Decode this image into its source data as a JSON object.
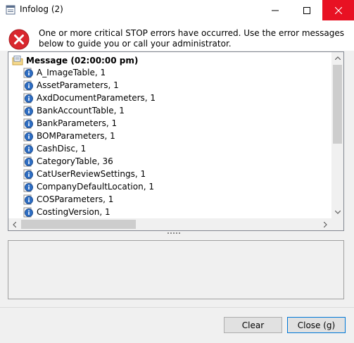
{
  "window": {
    "title": "Infolog (2)",
    "icons": {
      "app": "infolog-icon",
      "minimize": "minimize-icon",
      "maximize": "maximize-icon",
      "close": "close-icon"
    },
    "accent_close": "#e81123"
  },
  "header": {
    "icon": "stop-error-icon",
    "message": "One or more critical STOP errors have occurred. Use the error messages below to guide you or call your administrator."
  },
  "tree": {
    "root": {
      "icon": "message-folder-icon",
      "label": "Message (02:00:00 pm)"
    },
    "items": [
      {
        "icon": "info-icon",
        "label": "A_ImageTable, 1"
      },
      {
        "icon": "info-icon",
        "label": "AssetParameters, 1"
      },
      {
        "icon": "info-icon",
        "label": "AxdDocumentParameters, 1"
      },
      {
        "icon": "info-icon",
        "label": "BankAccountTable, 1"
      },
      {
        "icon": "info-icon",
        "label": "BankParameters, 1"
      },
      {
        "icon": "info-icon",
        "label": "BOMParameters, 1"
      },
      {
        "icon": "info-icon",
        "label": "CashDisc, 1"
      },
      {
        "icon": "info-icon",
        "label": "CategoryTable, 36"
      },
      {
        "icon": "info-icon",
        "label": "CatUserReviewSettings, 1"
      },
      {
        "icon": "info-icon",
        "label": "CompanyDefaultLocation, 1"
      },
      {
        "icon": "info-icon",
        "label": "COSParameters, 1"
      },
      {
        "icon": "info-icon",
        "label": "CostingVersion, 1"
      }
    ]
  },
  "buttons": {
    "clear": "Clear",
    "close": "Close (g)"
  }
}
